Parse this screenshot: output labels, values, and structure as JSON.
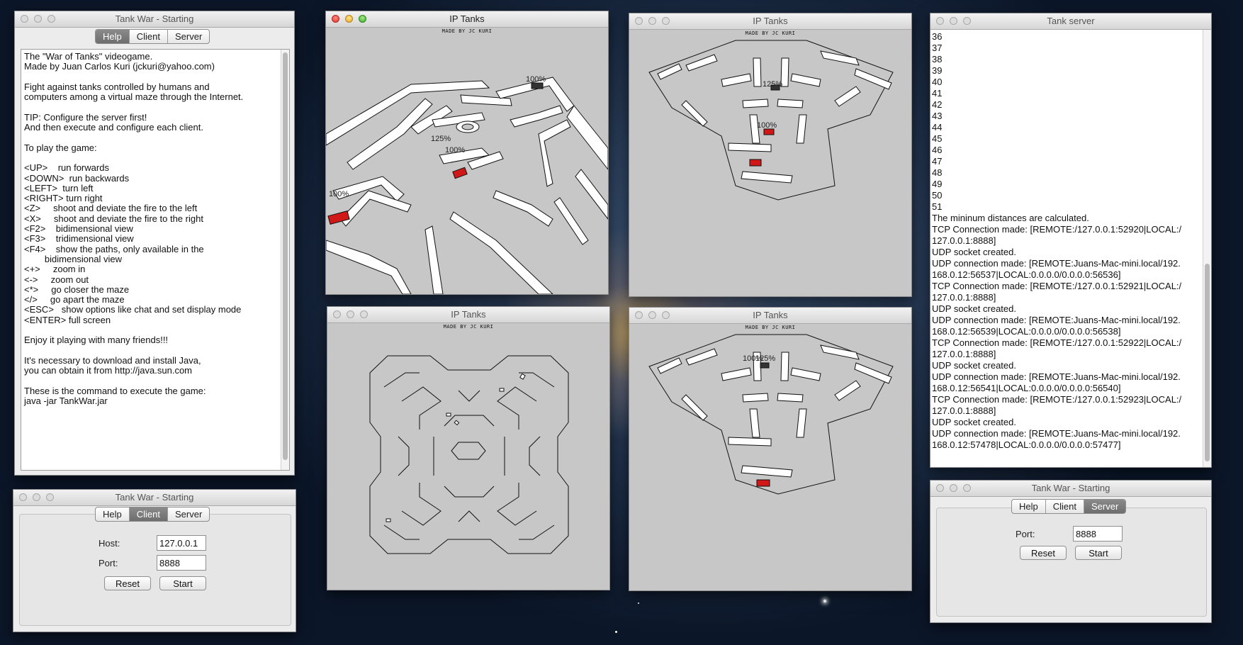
{
  "help_window": {
    "title": "Tank War - Starting",
    "tabs": [
      "Help",
      "Client",
      "Server"
    ],
    "selected_tab": "Help",
    "text": "The \"War of Tanks\" videogame.\nMade by Juan Carlos Kuri (jckuri@yahoo.com)\n\nFight against tanks controlled by humans and\ncomputers among a virtual maze through the Internet.\n\nTIP: Configure the server first!\nAnd then execute and configure each client.\n\nTo play the game:\n\n<UP>    run forwards\n<DOWN>  run backwards\n<LEFT>  turn left\n<RIGHT> turn right\n<Z>     shoot and deviate the fire to the left\n<X>     shoot and deviate the fire to the right\n<F2>    bidimensional view\n<F3>    tridimensional view\n<F4>    show the paths, only available in the\n        bidimensional view\n<+>     zoom in\n<->     zoom out\n<*>     go closer the maze\n</>     go apart the maze\n<ESC>   show options like chat and set display mode\n<ENTER> full screen\n\nEnjoy it playing with many friends!!!\n\nIt's necessary to download and install Java,\nyou can obtain it from http://java.sun.com\n\nThese is the command to execute the game:\njava -jar TankWar.jar"
  },
  "client_window": {
    "title": "Tank War - Starting",
    "tabs": [
      "Help",
      "Client",
      "Server"
    ],
    "selected_tab": "Client",
    "host_label": "Host:",
    "host_value": "127.0.0.1",
    "port_label": "Port:",
    "port_value": "8888",
    "reset_label": "Reset",
    "start_label": "Start"
  },
  "game_windows": [
    {
      "title": "IP Tanks",
      "credit": "MADE BY JC KURI",
      "view": "3D",
      "labels": [
        "100%",
        "125%",
        "100%",
        "100%"
      ]
    },
    {
      "title": "IP Tanks",
      "credit": "MADE BY JC KURI",
      "view": "3D",
      "labels": [
        "125%",
        "100%"
      ]
    },
    {
      "title": "IP Tanks",
      "credit": "MADE BY JC KURI",
      "view": "2D",
      "labels": []
    },
    {
      "title": "IP Tanks",
      "credit": "MADE BY JC KURI",
      "view": "3D",
      "labels": [
        "100%",
        "125%"
      ]
    }
  ],
  "server_log_window": {
    "title": "Tank server",
    "log": "36\n37\n38\n39\n40\n41\n42\n43\n44\n45\n46\n47\n48\n49\n50\n51\nThe mininum distances are calculated.\nTCP Connection made: [REMOTE:/127.0.0.1:52920|LOCAL:/\n127.0.0.1:8888]\nUDP socket created.\nUDP connection made: [REMOTE:Juans-Mac-mini.local/192.\n168.0.12:56537|LOCAL:0.0.0.0/0.0.0.0:56536]\nTCP Connection made: [REMOTE:/127.0.0.1:52921|LOCAL:/\n127.0.0.1:8888]\nUDP socket created.\nUDP connection made: [REMOTE:Juans-Mac-mini.local/192.\n168.0.12:56539|LOCAL:0.0.0.0/0.0.0.0:56538]\nTCP Connection made: [REMOTE:/127.0.0.1:52922|LOCAL:/\n127.0.0.1:8888]\nUDP socket created.\nUDP connection made: [REMOTE:Juans-Mac-mini.local/192.\n168.0.12:56541|LOCAL:0.0.0.0/0.0.0.0:56540]\nTCP Connection made: [REMOTE:/127.0.0.1:52923|LOCAL:/\n127.0.0.1:8888]\nUDP socket created.\nUDP connection made: [REMOTE:Juans-Mac-mini.local/192.\n168.0.12:57478|LOCAL:0.0.0.0/0.0.0.0:57477]"
  },
  "server_window": {
    "title": "Tank War - Starting",
    "tabs": [
      "Help",
      "Client",
      "Server"
    ],
    "selected_tab": "Server",
    "port_label": "Port:",
    "port_value": "8888",
    "reset_label": "Reset",
    "start_label": "Start"
  },
  "colors": {
    "tank_red": "#d01818",
    "maze_floor": "#c7c7c7",
    "wall_top": "#ffffff"
  }
}
